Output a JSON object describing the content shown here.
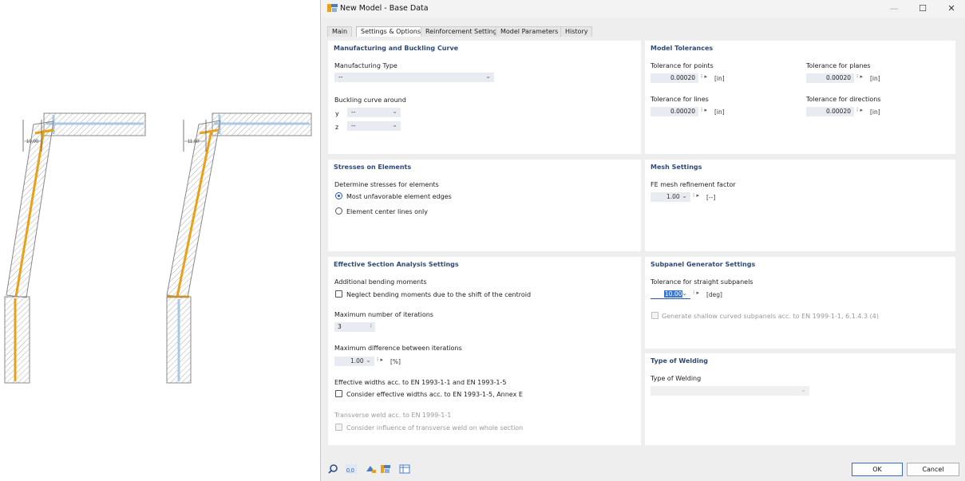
{
  "sketch": {
    "left_dimension": "10,00",
    "right_dimension": "11,00"
  },
  "window": {
    "title": "New Model - Base Data",
    "minimize_symbol": "—",
    "maximize_symbol": "☐",
    "close_symbol": "✕"
  },
  "tabs": [
    {
      "label": "Main"
    },
    {
      "label": "Settings & Options"
    },
    {
      "label": "Reinforcement Settings"
    },
    {
      "label": "Model Parameters"
    },
    {
      "label": "History"
    }
  ],
  "active_tab": "Settings & Options",
  "manufacturing": {
    "heading": "Manufacturing and Buckling Curve",
    "type_label": "Manufacturing Type",
    "type_value": "--",
    "buckling_label": "Buckling curve around",
    "y_label": "y",
    "y_value": "--",
    "z_label": "z",
    "z_value": "--"
  },
  "tolerances": {
    "heading": "Model Tolerances",
    "points_label": "Tolerance for points",
    "points_value": "0.00020",
    "points_unit": "[in]",
    "planes_label": "Tolerance for planes",
    "planes_value": "0.00020",
    "planes_unit": "[in]",
    "lines_label": "Tolerance for lines",
    "lines_value": "0.00020",
    "lines_unit": "[in]",
    "directions_label": "Tolerance for directions",
    "directions_value": "0.00020",
    "directions_unit": "[in]"
  },
  "stresses": {
    "heading": "Stresses on Elements",
    "determine_label": "Determine stresses for elements",
    "option_edges": "Most unfavorable element edges",
    "option_center": "Element center lines only",
    "selected": "Most unfavorable element edges"
  },
  "mesh": {
    "heading": "Mesh Settings",
    "factor_label": "FE mesh refinement factor",
    "factor_value": "1.00",
    "factor_unit": "[--]"
  },
  "effective": {
    "heading": "Effective Section Analysis Settings",
    "bending_label": "Additional bending moments",
    "neglect_label": "Neglect bending moments due to the shift of the centroid",
    "neglect_checked": false,
    "max_iter_label": "Maximum number of iterations",
    "max_iter_value": "3",
    "max_diff_label": "Maximum difference between iterations",
    "max_diff_value": "1.00",
    "max_diff_unit": "[%]",
    "eff_widths_label": "Effective widths acc. to EN 1993-1-1 and EN 1993-1-5",
    "consider_widths_label": "Consider effective widths acc. to EN 1993-1-5, Annex E",
    "consider_widths_checked": false,
    "weld_label": "Transverse weld acc. to EN 1999-1-1",
    "weld_influence_label": "Consider influence of transverse weld on whole section",
    "weld_influence_checked": false
  },
  "subpanel": {
    "heading": "Subpanel Generator Settings",
    "tol_label": "Tolerance for straight subpanels",
    "tol_value": "10.00",
    "tol_unit": "[deg]",
    "shallow_label": "Generate shallow curved subpanels acc. to EN 1999-1-1, 6.1.4.3 (4)",
    "shallow_checked": false
  },
  "welding": {
    "heading": "Type of Welding",
    "type_label": "Type of Welding",
    "type_value": ""
  },
  "footer": {
    "ok_label": "OK",
    "cancel_label": "Cancel",
    "icons": [
      "search-icon",
      "decimal-icon",
      "view-icon",
      "model-icon",
      "table-icon"
    ]
  },
  "colors": {
    "accent_orange": "#e8a21a",
    "accent_blue": "#a9c8e8",
    "heading_blue": "#2e4a78",
    "field_bg": "#e8ebf1"
  }
}
